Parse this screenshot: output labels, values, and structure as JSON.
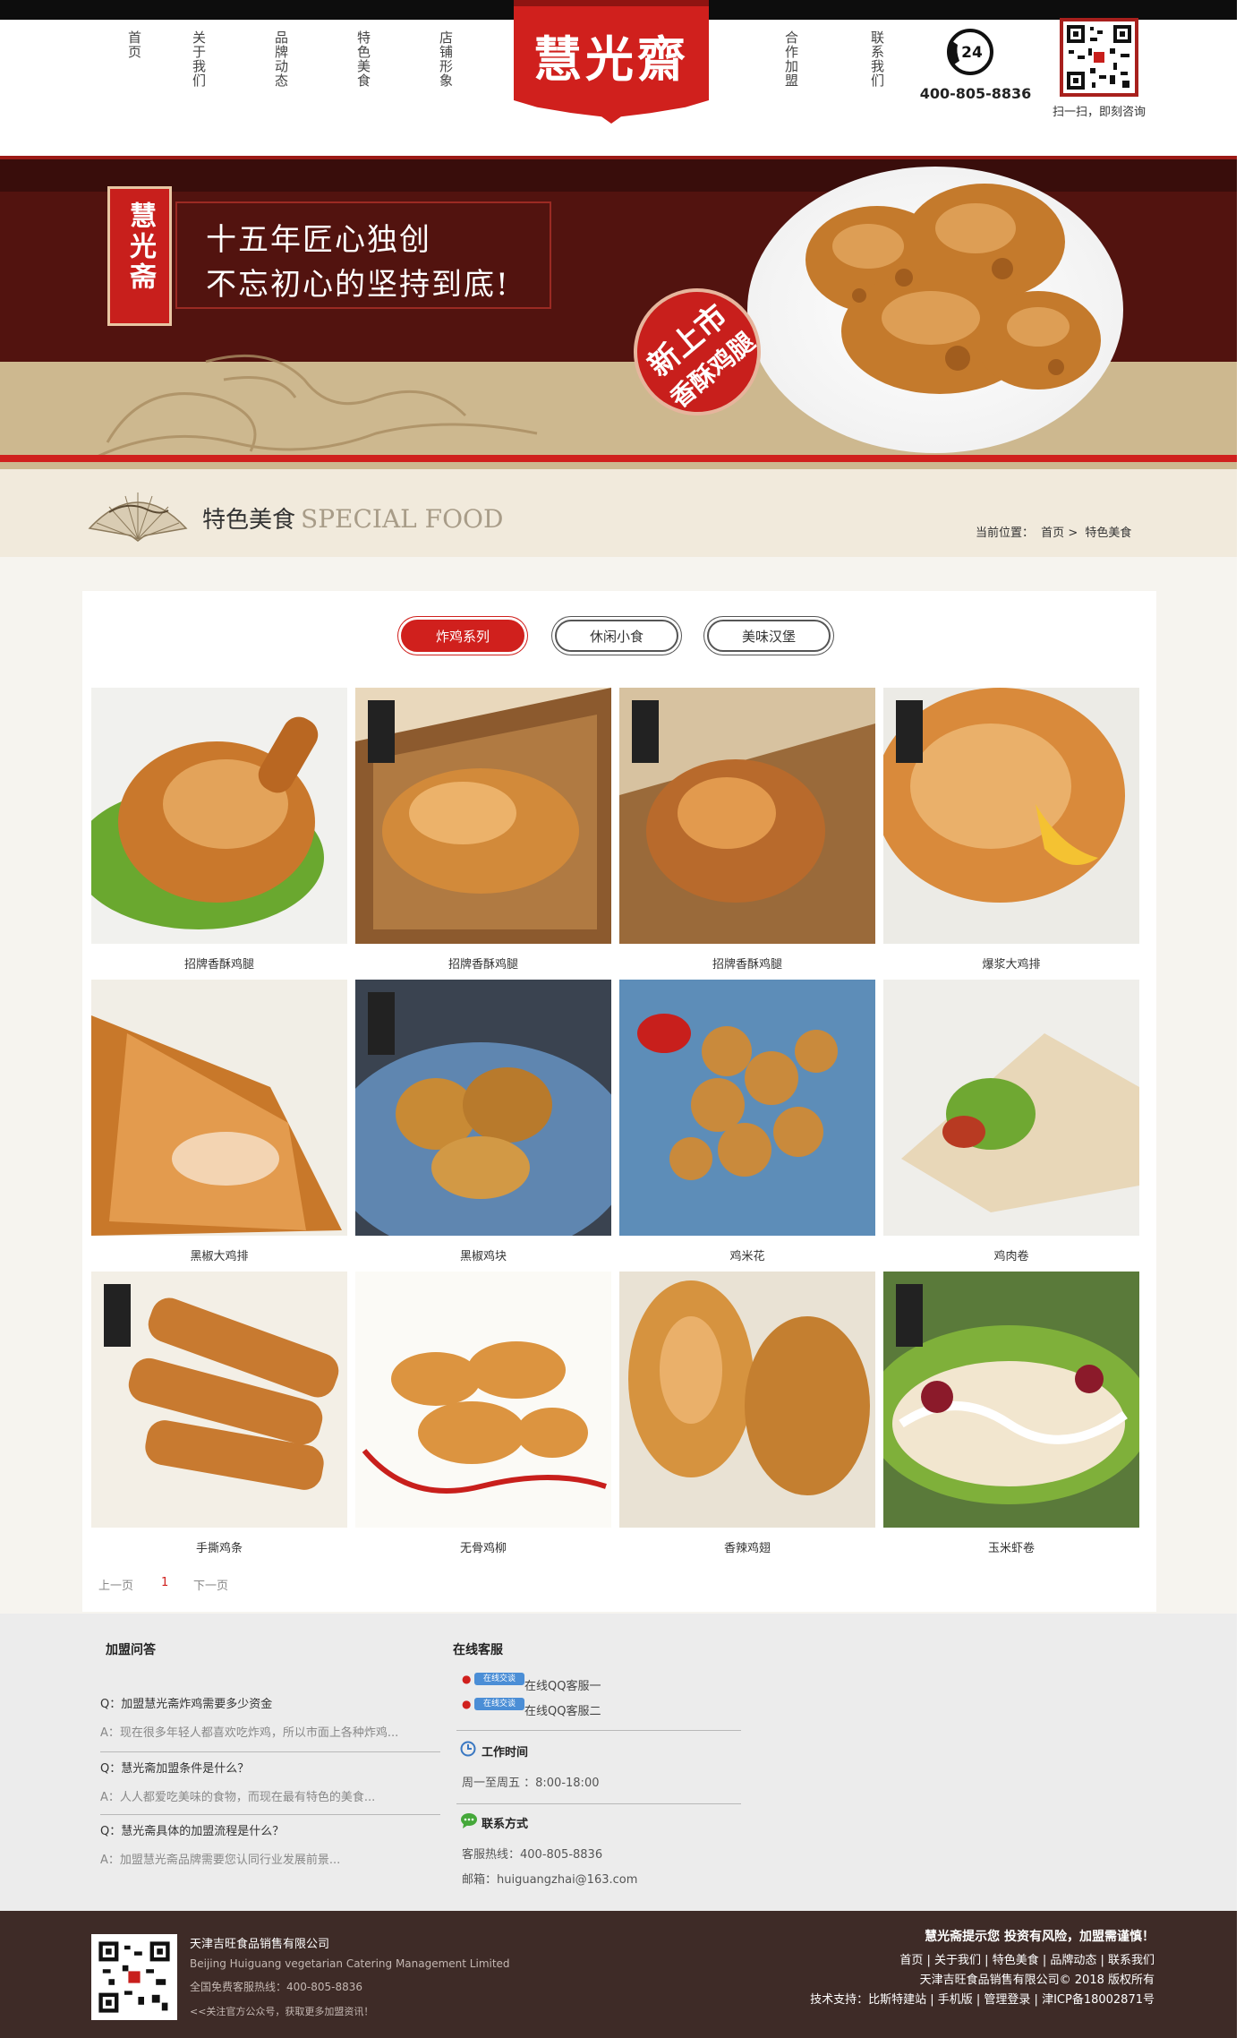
{
  "header": {
    "nav_left": [
      "首页",
      "关于我们",
      "品牌动态",
      "特色美食",
      "店铺形象"
    ],
    "nav_right": [
      "合作加盟",
      "联系我们"
    ],
    "logo": "慧光齋",
    "phone_badge": "24",
    "phone": "400-805-8836",
    "qr_caption": "扫一扫，即刻咨询"
  },
  "banner": {
    "seal": "慧光斋",
    "line1": "十五年匠心独创",
    "line2": "不忘初心的坚持到底!",
    "badge_line1": "新上市",
    "badge_line2": "香酥鸡腿"
  },
  "section": {
    "title": "特色美食",
    "title_en": "SPECIAL FOOD",
    "crumb_label": "当前位置：",
    "crumb_home": "首页",
    "crumb_sep": ">",
    "crumb_current": "特色美食"
  },
  "tabs": [
    {
      "label": "炸鸡系列",
      "active": true
    },
    {
      "label": "休闲小食",
      "active": false
    },
    {
      "label": "美味汉堡",
      "active": false
    }
  ],
  "products": [
    {
      "name": "招牌香酥鸡腿",
      "icon": "fried-chicken-leg-photo"
    },
    {
      "name": "招牌香酥鸡腿",
      "icon": "fried-chicken-box-photo"
    },
    {
      "name": "招牌香酥鸡腿",
      "icon": "fried-chicken-box-photo"
    },
    {
      "name": "爆浆大鸡排",
      "icon": "cheese-chicken-cutlet-photo"
    },
    {
      "name": "黑椒大鸡排",
      "icon": "chicken-cutlet-photo"
    },
    {
      "name": "黑椒鸡块",
      "icon": "chicken-nuggets-photo"
    },
    {
      "name": "鸡米花",
      "icon": "popcorn-chicken-photo"
    },
    {
      "name": "鸡肉卷",
      "icon": "chicken-wrap-photo"
    },
    {
      "name": "手撕鸡条",
      "icon": "chicken-strips-photo"
    },
    {
      "name": "无骨鸡柳",
      "icon": "boneless-chicken-photo"
    },
    {
      "name": "香辣鸡翅",
      "icon": "spicy-wings-photo"
    },
    {
      "name": "玉米虾卷",
      "icon": "shrimp-roll-photo"
    }
  ],
  "pager": {
    "prev": "上一页",
    "current": "1",
    "next": "下一页"
  },
  "faq": {
    "title": "加盟问答",
    "items": [
      {
        "q": "Q：加盟慧光斋炸鸡需要多少资金",
        "a": "A：现在很多年轻人都喜欢吃炸鸡，所以市面上各种炸鸡..."
      },
      {
        "q": "Q：慧光斋加盟条件是什么？",
        "a": "A：人人都爱吃美味的食物，而现在最有特色的美食..."
      },
      {
        "q": "Q：慧光斋具体的加盟流程是什么？",
        "a": "A：加盟慧光斋品牌需要您认同行业发展前景..."
      }
    ]
  },
  "service": {
    "title": "在线客服",
    "qq_badge": "在线交谈",
    "qq1": "在线QQ客服一",
    "qq2": "在线QQ客服二",
    "work_title": "工作时间",
    "work_hours": "周一至周五 ：8:00-18:00",
    "contact_title": "联系方式",
    "hotline": "客服热线：400-805-8836",
    "email": "邮箱：huiguangzhai@163.com"
  },
  "bottom": {
    "company": "天津吉旺食品销售有限公司",
    "company_en": "Beijing Huiguang vegetarian Catering Management Limited",
    "hotline": "全国免费客服热线：400-805-8836",
    "wechat_tip": "<<关注官方公众号，获取更多加盟资讯！",
    "warning": "慧光斋提示您 投资有风险，加盟需谨慎！",
    "links": "首页 | 关于我们 | 特色美食 | 品牌动态 | 联系我们",
    "copyright": "天津吉旺食品销售有限公司© 2018 版权所有",
    "support": "技术支持：比斯特建站 | 手机版 | 管理登录 | 津ICP备18002871号"
  },
  "colors": {
    "brand_red": "#d0201d",
    "footer_dark": "#3e2b27",
    "section_bg": "#f1eadc"
  }
}
